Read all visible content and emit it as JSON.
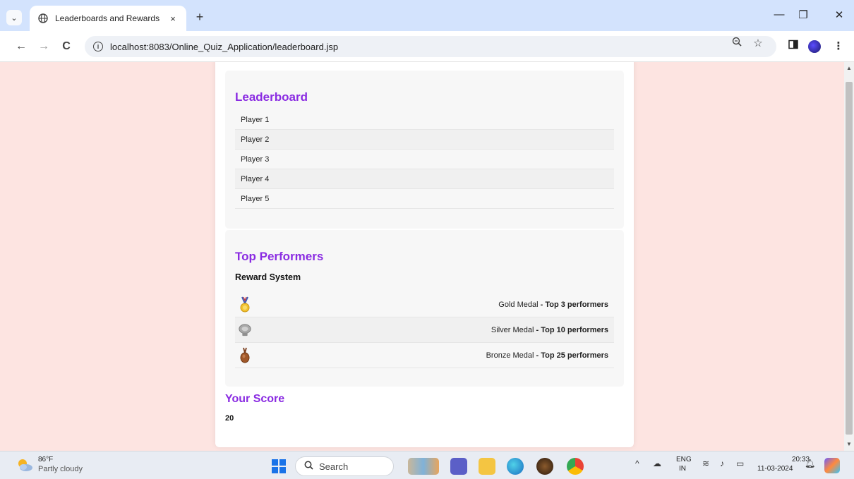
{
  "browser": {
    "tab_title": "Leaderboards and Rewards",
    "tab_close": "×",
    "new_tab": "+",
    "url": "localhost:8083/Online_Quiz_Application/leaderboard.jsp",
    "nav": {
      "back": "←",
      "forward": "→",
      "reload": "C"
    },
    "window": {
      "minimize": "—",
      "restore": "❐",
      "close": "✕"
    }
  },
  "page": {
    "leaderboard": {
      "title": "Leaderboard",
      "players": [
        "Player 1",
        "Player 2",
        "Player 3",
        "Player 4",
        "Player 5"
      ]
    },
    "top_performers": {
      "title": "Top Performers",
      "reward_heading": "Reward System",
      "rewards": [
        {
          "medal": "Gold Medal",
          "criteria": " - Top 3 performers",
          "icon": "gold-medal-icon"
        },
        {
          "medal": "Silver Medal",
          "criteria": " - Top 10 performers",
          "icon": "silver-medal-icon"
        },
        {
          "medal": "Bronze Medal",
          "criteria": " - Top 25 performers",
          "icon": "bronze-medal-icon"
        }
      ]
    },
    "score": {
      "title": "Your Score",
      "value": "20"
    }
  },
  "taskbar": {
    "weather_temp": "86°F",
    "weather_desc": "Partly cloudy",
    "search_placeholder": "Search",
    "lang_line1": "ENG",
    "lang_line2": "IN",
    "time": "20:33",
    "date": "11-03-2024"
  },
  "colors": {
    "accent": "#8a2be2",
    "page_bg": "#fde4e1",
    "tab_strip": "#d3e3fd"
  }
}
